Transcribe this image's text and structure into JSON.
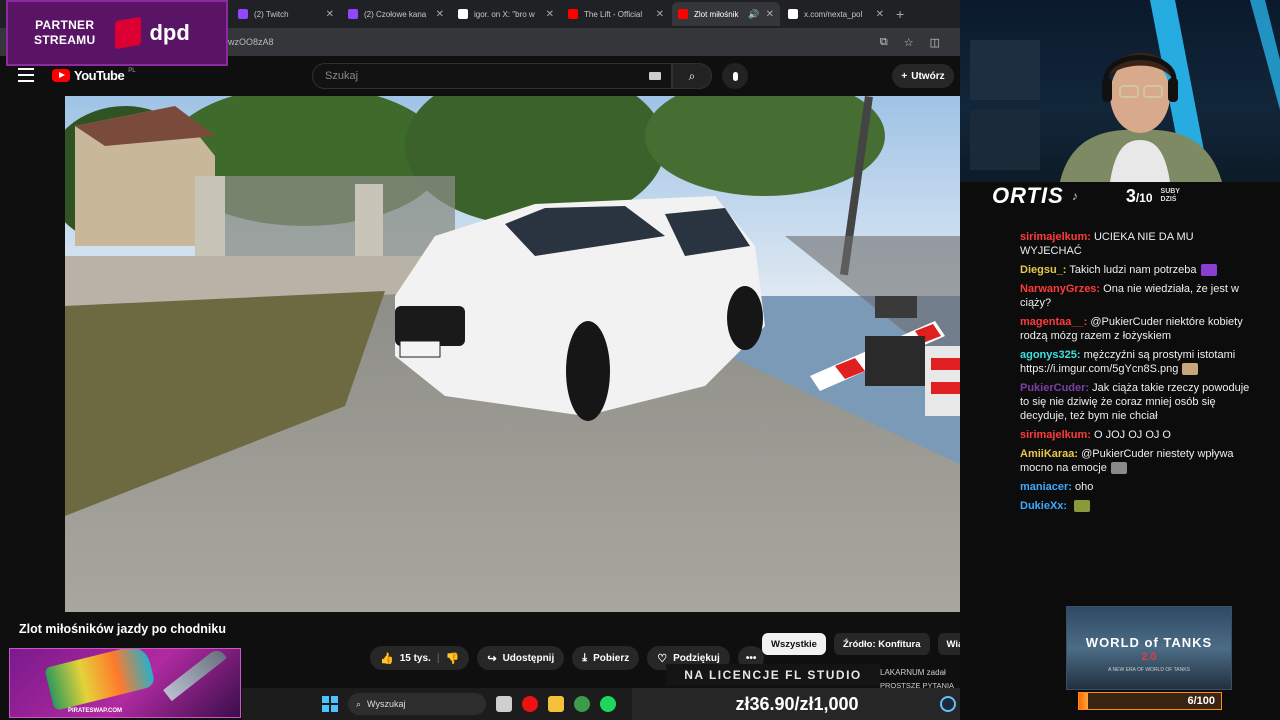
{
  "browser": {
    "tabs": [
      {
        "label": "(2) Twitch",
        "color": "#9146ff",
        "active": false
      },
      {
        "label": "(2) Czołowe kana",
        "color": "#9146ff",
        "active": false
      },
      {
        "label": "igor. on X: \"bro w",
        "color": "#ffffff",
        "active": false
      },
      {
        "label": "The Lift - Official",
        "color": "#ff0000",
        "active": false
      },
      {
        "label": "Zlot miłośnik",
        "color": "#ff0000",
        "active": true
      },
      {
        "label": "x.com/nexta_pol",
        "color": "#ffffff",
        "active": false
      }
    ],
    "url_fragment": "wzOO8zA8"
  },
  "youtube": {
    "logo_text": "YouTube",
    "country": "PL",
    "search_placeholder": "Szukaj",
    "create_label": "Utwórz",
    "video_title": "Zlot miłośników jazdy po chodniku",
    "likes": "15 tys.",
    "share_label": "Udostępnij",
    "download_label": "Pobierz",
    "thanks_label": "Podziękuj",
    "chips": [
      "Wszystkie",
      "Źródło: Konfitura",
      "Wiadomości ze"
    ],
    "sub_under_1": "LAKARNUM zadał",
    "sub_under_2": "PROSTSZE PYTANIA"
  },
  "overlays": {
    "partner_line1": "PARTNER",
    "partner_line2": "STREAMU",
    "partner_brand": "dpd",
    "ad_brand": "PIRATESWAP.COM",
    "licence": "NA LICENCJE FL STUDIO",
    "price": "zł36.90/zł1,000"
  },
  "taskbar": {
    "search_label": "Wyszukaj"
  },
  "streamer": {
    "name": "ORTIS",
    "subs_count": "3",
    "subs_goal": "/10",
    "subs_label_1": "SUBY",
    "subs_label_2": "DZIŚ"
  },
  "chat": [
    {
      "user": "sirimajelkum:",
      "color": "#ff3b3b",
      "text": "UCIEKA NIE DA MU WYJECHAĆ"
    },
    {
      "user": "Diegsu_:",
      "color": "#e8c84a",
      "text": "Takich ludzi nam potrzeba",
      "emote": "#8a3fd0"
    },
    {
      "user": "NarwanyGrzes:",
      "color": "#ff3b3b",
      "text": "Ona nie wiedziała, że jest w ciąży?"
    },
    {
      "user": "magentaa__:",
      "color": "#ff3b3b",
      "text": "@PukierCuder niektóre kobiety rodzą mózg razem z łożyskiem"
    },
    {
      "user": "agonys325:",
      "color": "#3fe0e0",
      "text": "mężczyźni są prostymi istotami https://i.imgur.com/5gYcn8S.png",
      "emote": "#c8a67a"
    },
    {
      "user": "PukierCuder:",
      "color": "#7a3fa8",
      "text": "Jak ciąża takie rzeczy powoduje to się nie dziwię że coraz mniej osób się decyduje, też bym nie chciał"
    },
    {
      "user": "sirimajelkum:",
      "color": "#ff3b3b",
      "text": "O JOJ OJ OJ O"
    },
    {
      "user": "AmiiKaraa:",
      "color": "#e8c84a",
      "text": "@PukierCuder niestety wpływa mocno na emocje",
      "emote": "#8a8a8a"
    },
    {
      "user": "maniacer:",
      "color": "#3fa8ff",
      "text": "oho"
    },
    {
      "user": "DukieXx:",
      "color": "#3fa8ff",
      "text": "",
      "emote": "#8a9a3a"
    }
  ],
  "wot": {
    "title": "WORLD of TANKS",
    "version": "2.0",
    "tagline": "A NEW ERA OF WORLD OF TANKS"
  },
  "goal": {
    "label": "6/100",
    "value": 6,
    "max": 100
  }
}
